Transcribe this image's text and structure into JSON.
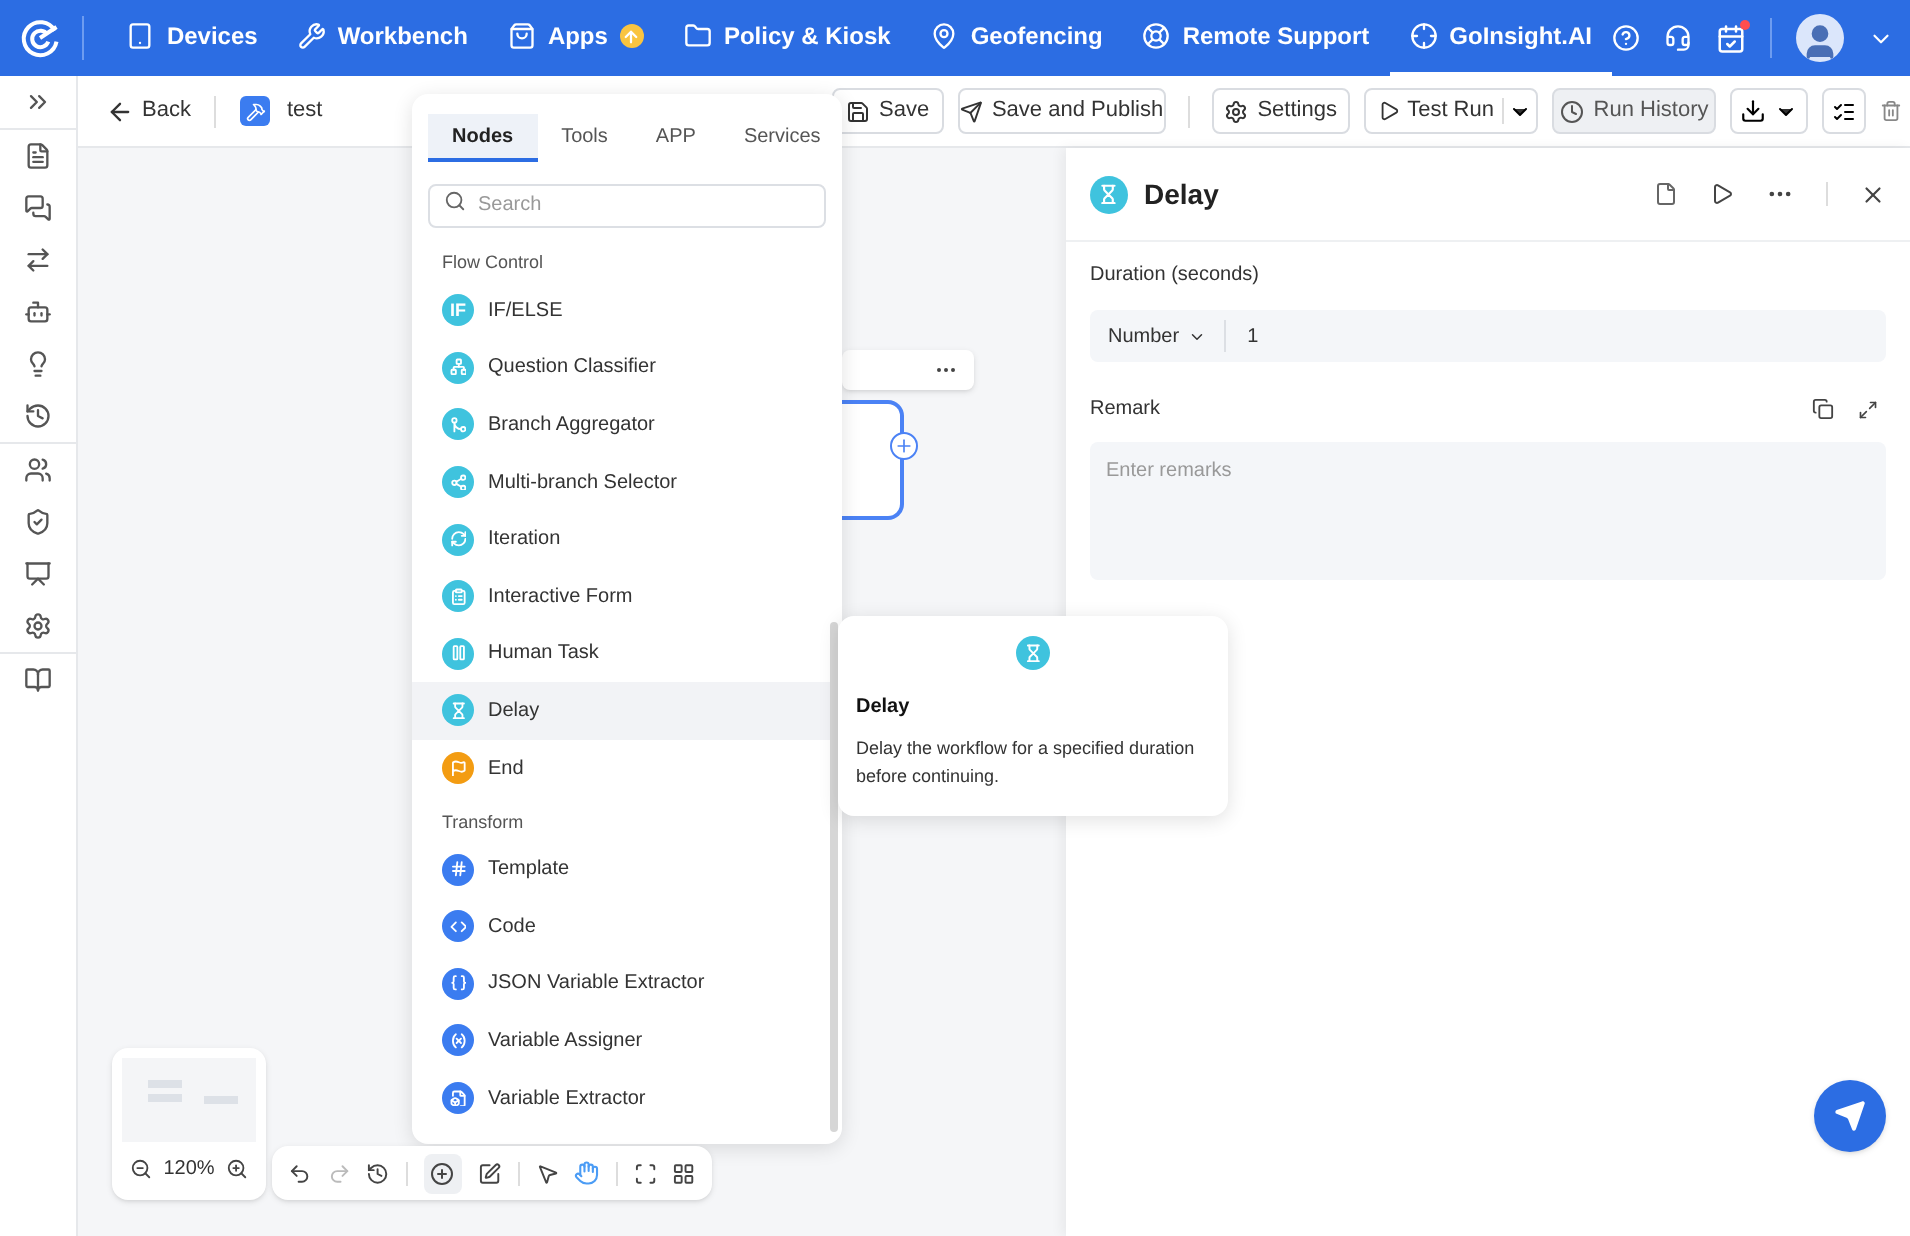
{
  "nav": {
    "items": [
      {
        "label": "Devices",
        "selected": false
      },
      {
        "label": "Workbench",
        "selected": false
      },
      {
        "label": "Apps",
        "selected": false,
        "badge": true
      },
      {
        "label": "Policy & Kiosk",
        "selected": false
      },
      {
        "label": "Geofencing",
        "selected": false
      },
      {
        "label": "Remote Support",
        "selected": false
      },
      {
        "label": "GoInsight.AI",
        "selected": true
      }
    ],
    "alert": true
  },
  "header": {
    "back": "Back",
    "title": "test",
    "buttons": [
      "Save",
      "Save and Publish",
      "Settings",
      "Test Run",
      "Run History"
    ]
  },
  "palette": {
    "tabs": [
      {
        "label": "Nodes",
        "selected": true
      },
      {
        "label": "Tools",
        "selected": false
      },
      {
        "label": "APP",
        "selected": false
      },
      {
        "label": "Services",
        "selected": false
      }
    ],
    "search": {
      "placeholder": "Search"
    },
    "groups": [
      {
        "title": "Flow Control",
        "items": [
          {
            "label": "IF/ELSE",
            "kind": "if",
            "icon_text": "IF",
            "selected": false
          },
          {
            "label": "Question Classifier",
            "kind": "classifier",
            "selected": false
          },
          {
            "label": "Branch Aggregator",
            "kind": "aggregator",
            "selected": false
          },
          {
            "label": "Multi-branch Selector",
            "kind": "selector",
            "selected": false
          },
          {
            "label": "Iteration",
            "kind": "iteration",
            "selected": false
          },
          {
            "label": "Interactive Form",
            "kind": "form",
            "selected": false
          },
          {
            "label": "Human Task",
            "kind": "human",
            "selected": false
          },
          {
            "label": "Delay",
            "kind": "delay",
            "selected": true
          },
          {
            "label": "End",
            "kind": "end",
            "selected": false
          }
        ]
      },
      {
        "title": "Transform",
        "items": [
          {
            "label": "Template",
            "kind": "template",
            "selected": false
          },
          {
            "label": "Code",
            "kind": "code",
            "selected": false
          },
          {
            "label": "JSON Variable Extractor",
            "kind": "json",
            "selected": false
          },
          {
            "label": "Variable Assigner",
            "kind": "assigner",
            "selected": false
          },
          {
            "label": "Variable Extractor",
            "kind": "extractor",
            "selected": false
          }
        ]
      }
    ]
  },
  "tooltip": {
    "title": "Delay",
    "text": "Delay the workflow for a specified duration before continuing."
  },
  "panel": {
    "title": "Delay",
    "duration_label": "Duration (seconds)",
    "type": "Number",
    "value": "1",
    "remark_label": "Remark",
    "remark_placeholder": "Enter remarks"
  },
  "zoom": "120%"
}
